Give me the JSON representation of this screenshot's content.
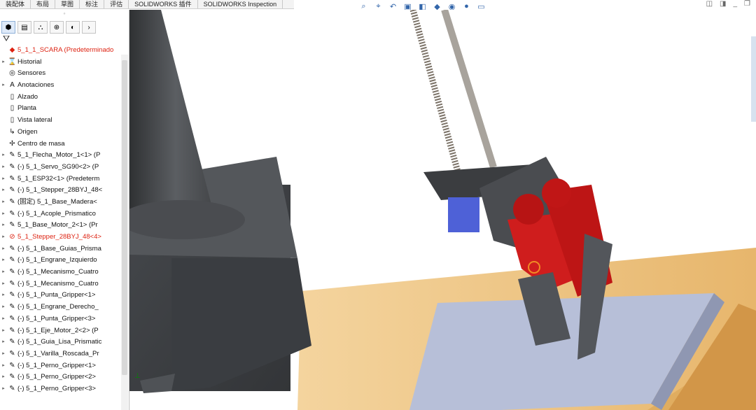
{
  "top_tabs": [
    "装配体",
    "布局",
    "草图",
    "标注",
    "评估",
    "SOLIDWORKS 插件",
    "SOLIDWORKS Inspection"
  ],
  "tree": [
    {
      "label": "5_1_1_SCARA (Predeterminado",
      "icon": "assembly-error-icon",
      "expand": false,
      "error": true
    },
    {
      "label": "Historial",
      "icon": "history-icon",
      "expand": true
    },
    {
      "label": "Sensores",
      "icon": "sensor-icon",
      "expand": false
    },
    {
      "label": "Anotaciones",
      "icon": "annotation-icon",
      "expand": true
    },
    {
      "label": "Alzado",
      "icon": "plane-icon",
      "expand": false
    },
    {
      "label": "Planta",
      "icon": "plane-icon",
      "expand": false
    },
    {
      "label": "Vista lateral",
      "icon": "plane-icon",
      "expand": false
    },
    {
      "label": "Origen",
      "icon": "origin-icon",
      "expand": false
    },
    {
      "label": "Centro de masa",
      "icon": "center-of-mass-icon",
      "expand": false
    },
    {
      "label": "5_1_Flecha_Motor_1<1> (P",
      "icon": "part-icon",
      "expand": true
    },
    {
      "label": "(-) 5_1_Servo_SG90<2> (P",
      "icon": "part-icon",
      "expand": true
    },
    {
      "label": "5_1_ESP32<1> (Predeterm",
      "icon": "part-icon",
      "expand": true
    },
    {
      "label": "(-) 5_1_Stepper_28BYJ_48<",
      "icon": "part-icon",
      "expand": true
    },
    {
      "label": "(固定) 5_1_Base_Madera<",
      "icon": "part-icon",
      "expand": true
    },
    {
      "label": "(-) 5_1_Acople_Prismatico",
      "icon": "part-icon",
      "expand": true
    },
    {
      "label": "5_1_Base_Motor_2<1> (Pr",
      "icon": "part-icon",
      "expand": true
    },
    {
      "label": "5_1_Stepper_28BYJ_48<4>",
      "icon": "part-error-icon",
      "expand": true,
      "error": true
    },
    {
      "label": "(-) 5_1_Base_Guias_Prisma",
      "icon": "part-icon",
      "expand": true
    },
    {
      "label": "(-) 5_1_Engrane_Izquierdo",
      "icon": "part-icon",
      "expand": true
    },
    {
      "label": "(-) 5_1_Mecanismo_Cuatro",
      "icon": "part-icon",
      "expand": true
    },
    {
      "label": "(-) 5_1_Mecanismo_Cuatro",
      "icon": "part-icon",
      "expand": true
    },
    {
      "label": "(-) 5_1_Punta_Gripper<1>",
      "icon": "part-icon",
      "expand": true
    },
    {
      "label": "(-) 5_1_Engrane_Derecho_",
      "icon": "part-icon",
      "expand": true
    },
    {
      "label": "(-) 5_1_Punta_Gripper<3>",
      "icon": "part-icon",
      "expand": true
    },
    {
      "label": "(-) 5_1_Eje_Motor_2<2> (P",
      "icon": "part-icon",
      "expand": true
    },
    {
      "label": "(-) 5_1_Guia_Lisa_Prismatic",
      "icon": "part-icon",
      "expand": true
    },
    {
      "label": "(-) 5_1_Varilla_Roscada_Pr",
      "icon": "part-icon",
      "expand": true
    },
    {
      "label": "(-) 5_1_Perno_Gripper<1>",
      "icon": "part-icon",
      "expand": true
    },
    {
      "label": "(-) 5_1_Perno_Gripper<2>",
      "icon": "part-icon",
      "expand": true
    },
    {
      "label": "(-) 5_1_Perno_Gripper<3>",
      "icon": "part-icon",
      "expand": true
    }
  ]
}
